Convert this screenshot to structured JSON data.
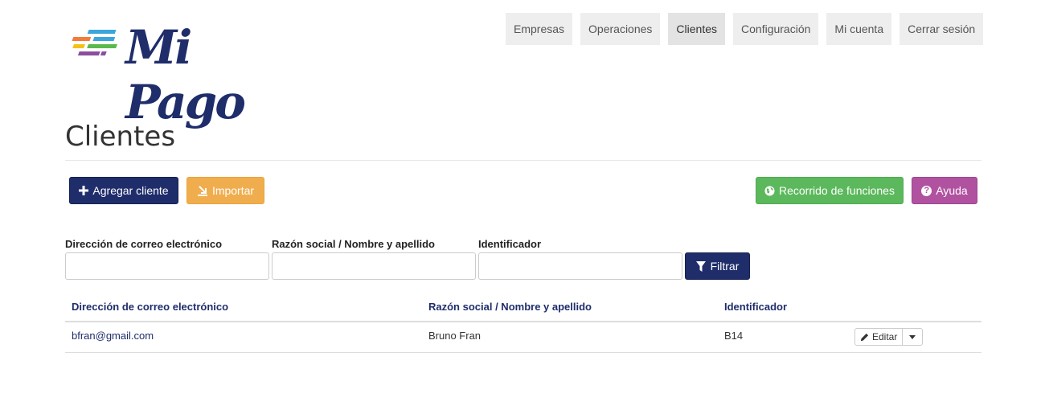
{
  "brand": {
    "logo_text": "Mi Pago",
    "color": "#1f2d6b"
  },
  "nav": {
    "items": [
      {
        "label": "Empresas"
      },
      {
        "label": "Operaciones"
      },
      {
        "label": "Clientes",
        "active": true
      },
      {
        "label": "Configuración"
      },
      {
        "label": "Mi cuenta"
      },
      {
        "label": "Cerrar sesión"
      }
    ]
  },
  "page": {
    "title": "Clientes"
  },
  "actions": {
    "add_label": "Agregar cliente",
    "import_label": "Importar",
    "tour_label": "Recorrido de funciones",
    "help_label": "Ayuda"
  },
  "filters": {
    "email_label": "Dirección de correo electrónico",
    "email_value": "",
    "name_label": "Razón social / Nombre y apellido",
    "name_value": "",
    "id_label": "Identificador",
    "id_value": "",
    "filter_label": "Filtrar"
  },
  "table": {
    "headers": {
      "email": "Dirección de correo electrónico",
      "name": "Razón social / Nombre y apellido",
      "id": "Identificador"
    },
    "rows": [
      {
        "email": "bfran@gmail.com",
        "name": "Bruno Fran",
        "id": "B14",
        "edit_label": "Editar"
      }
    ]
  },
  "colors": {
    "primary": "#1f2d6b",
    "warning": "#f0ad4e",
    "success": "#5cb85c",
    "help": "#b152a0"
  },
  "icons": {
    "add": "plus-icon",
    "import": "import-icon",
    "tour": "globe-icon",
    "help": "question-circle-icon",
    "filter": "filter-icon",
    "edit": "pencil-icon",
    "dropdown": "caret-down-icon"
  }
}
